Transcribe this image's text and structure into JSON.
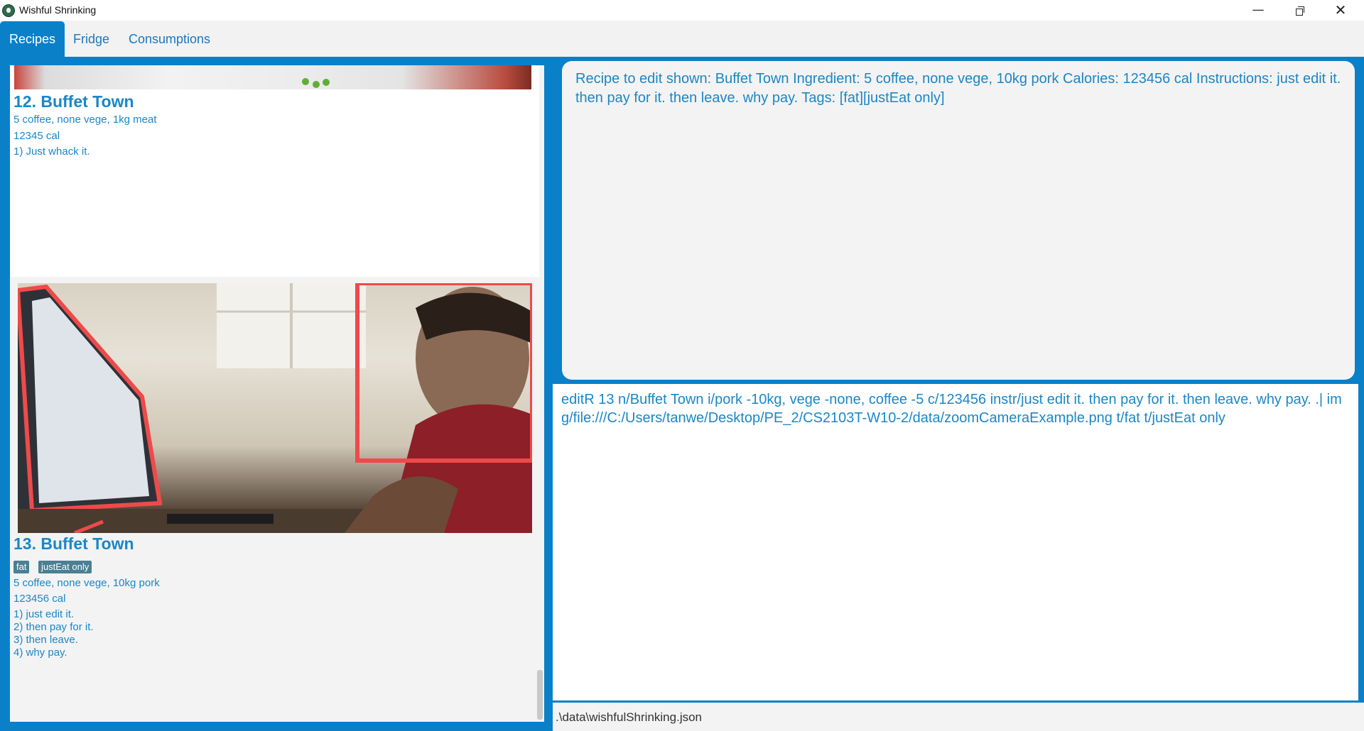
{
  "window": {
    "title": "Wishful Shrinking",
    "minimize": "—",
    "close": "✕"
  },
  "tabs": [
    {
      "label": "Recipes",
      "active": true
    },
    {
      "label": "Fridge",
      "active": false
    },
    {
      "label": "Consumptions",
      "active": false
    }
  ],
  "recipes": [
    {
      "title": "12.  Buffet Town",
      "ingredients": "5 coffee, none vege, 1kg meat",
      "calories": "12345 cal",
      "instructions": [
        "1) Just whack it."
      ]
    },
    {
      "title": "13.  Buffet Town",
      "tags": [
        "fat",
        "justEat only"
      ],
      "ingredients": "5 coffee, none vege, 10kg pork",
      "calories": "123456 cal",
      "instructions": [
        "1) just edit it.",
        "2) then pay for it.",
        "3) then leave.",
        "4) why pay."
      ]
    }
  ],
  "result": {
    "text": "Recipe to edit shown: Buffet Town Ingredient: 5 coffee, none vege, 10kg pork Calories: 123456 cal Instructions: just edit it.  then pay for it.  then leave.  why pay. Tags: [fat][justEat only]"
  },
  "command": {
    "value": "editR 13 n/Buffet Town i/pork -10kg, vege -none, coffee -5 c/123456 instr/just edit it. then pay for it. then leave. why pay. .| img/file:///C:/Users/tanwe/Desktop/PE_2/CS2103T-W10-2/data/zoomCameraExample.png t/fat t/justEat only"
  },
  "status": {
    "file_path": ".\\data\\wishfulShrinking.json"
  },
  "colors": {
    "accent": "#0a80c9",
    "text": "#1a87c6",
    "panel": "#f3f3f3",
    "tag": "#4a7f94"
  }
}
